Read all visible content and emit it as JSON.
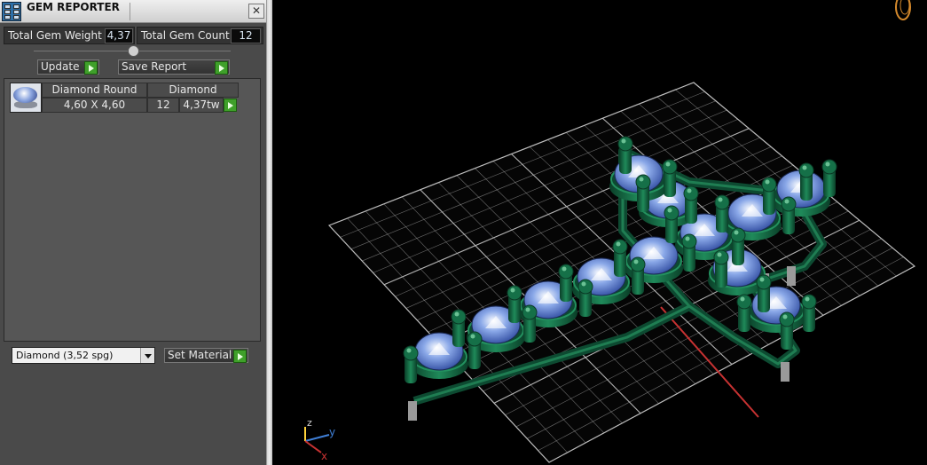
{
  "window": {
    "title": "GEM REPORTER",
    "close_glyph": "✕"
  },
  "stats": {
    "total_weight_label": "Total Gem Weight",
    "total_weight_value": "4,37",
    "total_count_label": "Total Gem Count",
    "total_count_value": "12"
  },
  "buttons": {
    "update": "Update",
    "save_report": "Save Report",
    "set_material": "Set Material"
  },
  "gem_list": {
    "rows": [
      {
        "shape": "Diamond Round",
        "material": "Diamond",
        "size": "4,60 X 4,60",
        "count": "12",
        "weight": "4,37tw"
      }
    ]
  },
  "material_select": {
    "value": "Diamond      (3,52 spg)"
  },
  "axis": {
    "x": "x",
    "y": "y",
    "z": "z"
  },
  "colors": {
    "metal": "#0f5a3a",
    "gem": "#8aa8e8",
    "grid": "#bdbdbd",
    "axis_x": "#c83232",
    "axis_y": "#3f7fd6",
    "axis_z": "#ffd23a"
  }
}
